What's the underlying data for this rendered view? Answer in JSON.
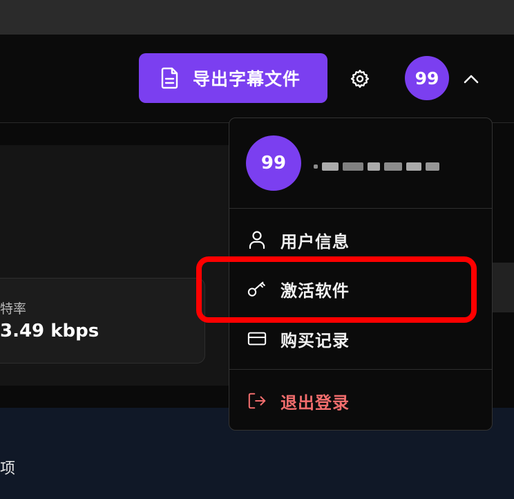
{
  "header": {
    "export_button_label": "导出字幕文件",
    "avatar_text": "99"
  },
  "content": {
    "stat_label": "特率",
    "stat_value": "3.49 kbps",
    "bottom_text": "项"
  },
  "dropdown": {
    "avatar_text": "99",
    "items": [
      {
        "label": "用户信息",
        "icon": "user-icon"
      },
      {
        "label": "激活软件",
        "icon": "key-icon"
      },
      {
        "label": "购买记录",
        "icon": "credit-card-icon"
      },
      {
        "label": "退出登录",
        "icon": "logout-icon"
      }
    ]
  },
  "colors": {
    "accent": "#7b3ff0",
    "highlight": "#ff0000",
    "logout": "#f26d6d"
  }
}
